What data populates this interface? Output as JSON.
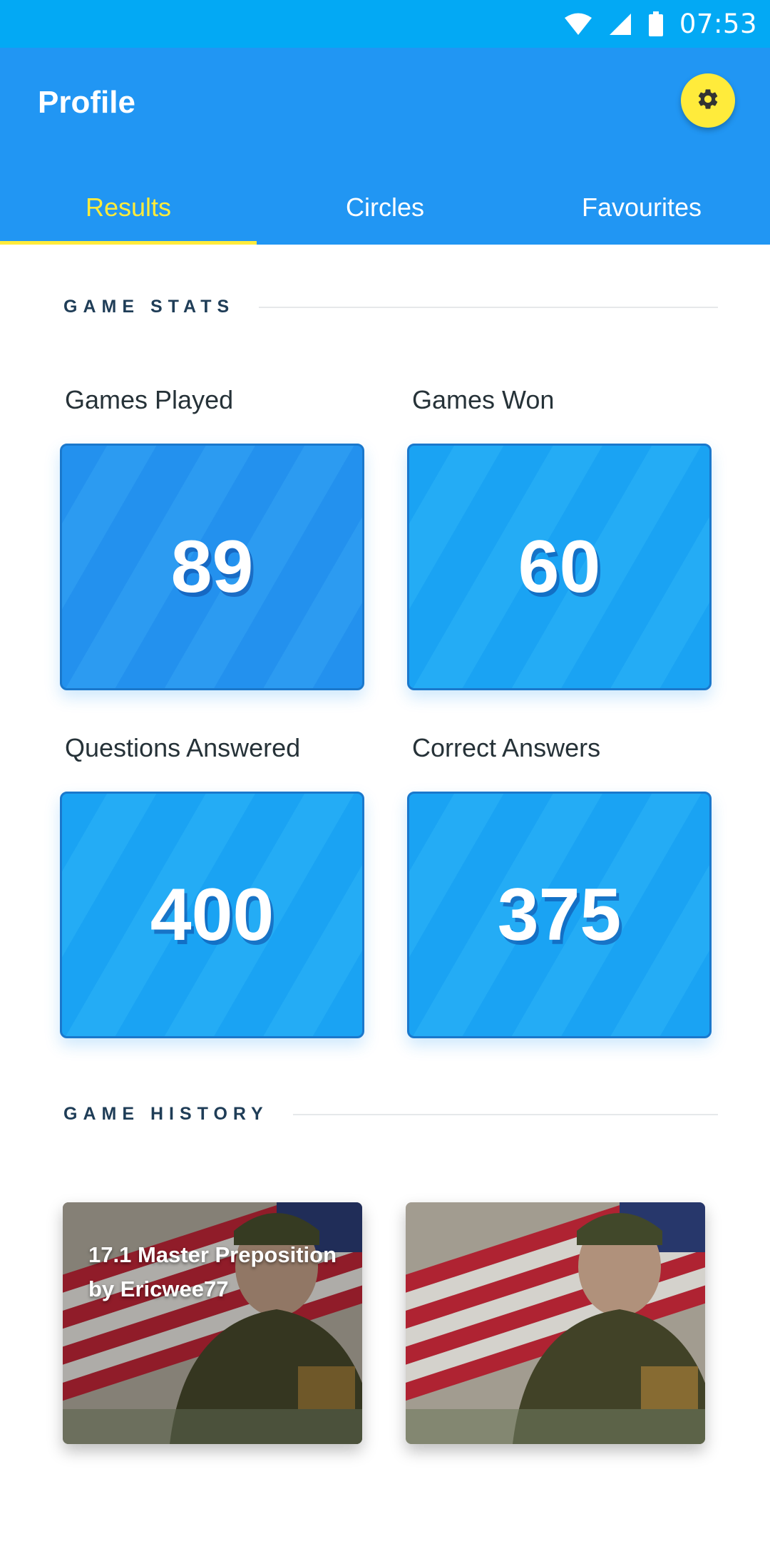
{
  "status_bar": {
    "time": "07:53",
    "icons": [
      "wifi-icon",
      "signal-icon",
      "battery-icon"
    ]
  },
  "app_bar": {
    "title": "Profile",
    "settings_icon": "gear-icon",
    "tabs": [
      {
        "label": "Results",
        "active": true
      },
      {
        "label": "Circles",
        "active": false
      },
      {
        "label": "Favourites",
        "active": false
      }
    ]
  },
  "game_stats": {
    "heading": "GAME STATS",
    "items": [
      {
        "label": "Games Played",
        "value": "89"
      },
      {
        "label": "Games Won",
        "value": "60"
      },
      {
        "label": "Questions Answered",
        "value": "400"
      },
      {
        "label": "Correct Answers",
        "value": "375"
      }
    ]
  },
  "game_history": {
    "heading": "GAME HISTORY",
    "items": [
      {
        "title": "17.1 Master Preposition",
        "author": "by Ericwee77"
      },
      {
        "title": "",
        "author": ""
      }
    ]
  },
  "colors": {
    "status_bar": "#03a9f4",
    "app_bar": "#2196f3",
    "accent": "#ffeb3b",
    "card_dark": "#2391ee",
    "card_light": "#1aa3f3"
  }
}
